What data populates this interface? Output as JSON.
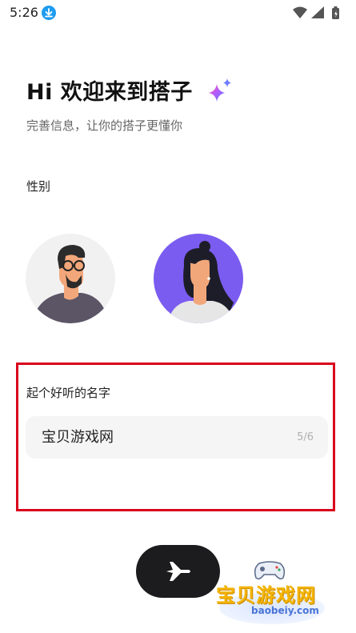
{
  "status_bar": {
    "time": "5:26",
    "icons": [
      "download-icon",
      "wifi-icon",
      "signal-icon",
      "battery-icon"
    ]
  },
  "header": {
    "title": "Hi 欢迎来到搭子",
    "title_icon": "sparkle-icon",
    "subtitle": "完善信息，让你的搭子更懂你"
  },
  "gender": {
    "label": "性别",
    "options": [
      "male-avatar",
      "female-avatar"
    ]
  },
  "name_section": {
    "label": "起个好听的名字",
    "value": "宝贝游戏网",
    "counter": "5/6"
  },
  "next_button": {
    "icon": "paper-plane-icon"
  },
  "watermark": {
    "text": "宝贝游戏网",
    "url": "baobeiy.com"
  },
  "colors": {
    "highlight_border": "#d9001b",
    "female_avatar_bg": "#7b5cf0",
    "button_bg": "#1c1c1e",
    "download_badge": "#1e9cf0"
  }
}
